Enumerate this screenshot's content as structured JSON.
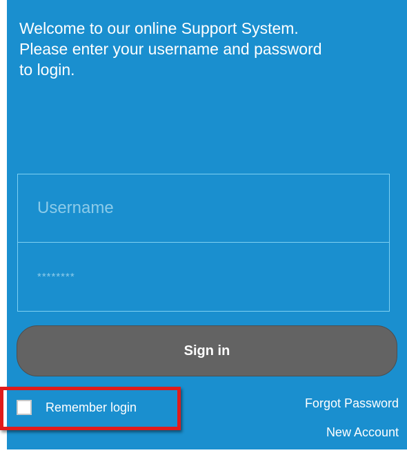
{
  "welcome": {
    "line1": "Welcome to our online Support System.",
    "line2": "Please enter your username and password",
    "line3": "to login."
  },
  "form": {
    "username_placeholder": "Username",
    "password_placeholder": "********",
    "signin_label": "Sign in",
    "remember_label": "Remember login",
    "remember_checked": false
  },
  "links": {
    "forgot_password": "Forgot Password",
    "new_account": "New Account"
  },
  "colors": {
    "panel_bg": "#1a8fcf",
    "field_border": "#7fd0f2",
    "button_bg": "#636363",
    "highlight": "#e01b1b"
  }
}
